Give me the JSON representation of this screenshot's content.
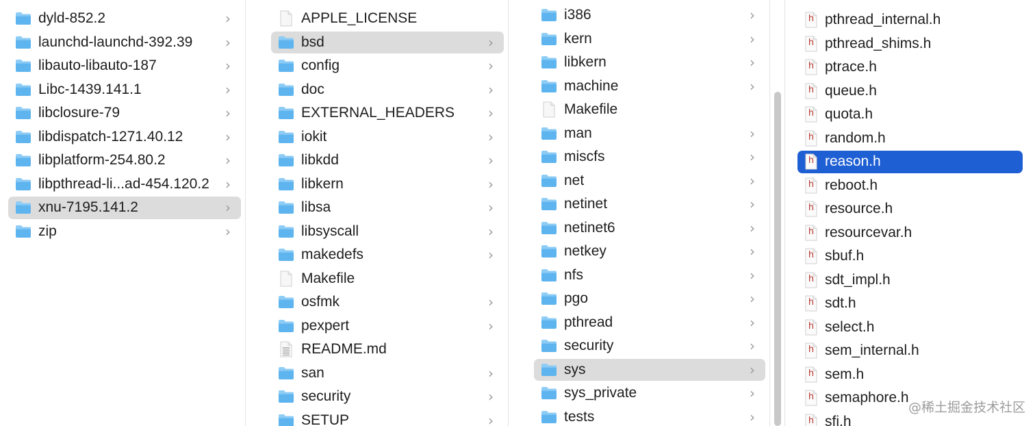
{
  "columns": [
    {
      "items": [
        {
          "label": "dyld-852.2",
          "type": "folder",
          "chevron": true
        },
        {
          "label": "launchd-launchd-392.39",
          "type": "folder",
          "chevron": true
        },
        {
          "label": "libauto-libauto-187",
          "type": "folder",
          "chevron": true
        },
        {
          "label": "Libc-1439.141.1",
          "type": "folder",
          "chevron": true
        },
        {
          "label": "libclosure-79",
          "type": "folder",
          "chevron": true
        },
        {
          "label": "libdispatch-1271.40.12",
          "type": "folder",
          "chevron": true
        },
        {
          "label": "libplatform-254.80.2",
          "type": "folder",
          "chevron": true
        },
        {
          "label": "libpthread-li...ad-454.120.2",
          "type": "folder",
          "chevron": true
        },
        {
          "label": "xnu-7195.141.2",
          "type": "folder",
          "chevron": true,
          "selected": "grey"
        },
        {
          "label": "zip",
          "type": "folder",
          "chevron": true
        }
      ]
    },
    {
      "items": [
        {
          "label": "APPLE_LICENSE",
          "type": "doc",
          "chevron": false
        },
        {
          "label": "bsd",
          "type": "folder",
          "chevron": true,
          "selected": "grey"
        },
        {
          "label": "config",
          "type": "folder",
          "chevron": true
        },
        {
          "label": "doc",
          "type": "folder",
          "chevron": true
        },
        {
          "label": "EXTERNAL_HEADERS",
          "type": "folder",
          "chevron": true
        },
        {
          "label": "iokit",
          "type": "folder",
          "chevron": true
        },
        {
          "label": "libkdd",
          "type": "folder",
          "chevron": true
        },
        {
          "label": "libkern",
          "type": "folder",
          "chevron": true
        },
        {
          "label": "libsa",
          "type": "folder",
          "chevron": true
        },
        {
          "label": "libsyscall",
          "type": "folder",
          "chevron": true
        },
        {
          "label": "makedefs",
          "type": "folder",
          "chevron": true
        },
        {
          "label": "Makefile",
          "type": "doc",
          "chevron": false
        },
        {
          "label": "osfmk",
          "type": "folder",
          "chevron": true
        },
        {
          "label": "pexpert",
          "type": "folder",
          "chevron": true
        },
        {
          "label": "README.md",
          "type": "textdoc",
          "chevron": false
        },
        {
          "label": "san",
          "type": "folder",
          "chevron": true
        },
        {
          "label": "security",
          "type": "folder",
          "chevron": true
        },
        {
          "label": "SETUP",
          "type": "folder",
          "chevron": true
        }
      ]
    },
    {
      "items": [
        {
          "label": "i386",
          "type": "folder",
          "chevron": true
        },
        {
          "label": "kern",
          "type": "folder",
          "chevron": true
        },
        {
          "label": "libkern",
          "type": "folder",
          "chevron": true
        },
        {
          "label": "machine",
          "type": "folder",
          "chevron": true
        },
        {
          "label": "Makefile",
          "type": "doc",
          "chevron": false
        },
        {
          "label": "man",
          "type": "folder",
          "chevron": true
        },
        {
          "label": "miscfs",
          "type": "folder",
          "chevron": true
        },
        {
          "label": "net",
          "type": "folder",
          "chevron": true
        },
        {
          "label": "netinet",
          "type": "folder",
          "chevron": true
        },
        {
          "label": "netinet6",
          "type": "folder",
          "chevron": true
        },
        {
          "label": "netkey",
          "type": "folder",
          "chevron": true
        },
        {
          "label": "nfs",
          "type": "folder",
          "chevron": true
        },
        {
          "label": "pgo",
          "type": "folder",
          "chevron": true
        },
        {
          "label": "pthread",
          "type": "folder",
          "chevron": true
        },
        {
          "label": "security",
          "type": "folder",
          "chevron": true
        },
        {
          "label": "sys",
          "type": "folder",
          "chevron": true,
          "selected": "grey"
        },
        {
          "label": "sys_private",
          "type": "folder",
          "chevron": true
        },
        {
          "label": "tests",
          "type": "folder",
          "chevron": true
        }
      ]
    },
    {
      "items": [
        {
          "label": "pthread_internal.h",
          "type": "h"
        },
        {
          "label": "pthread_shims.h",
          "type": "h"
        },
        {
          "label": "ptrace.h",
          "type": "h"
        },
        {
          "label": "queue.h",
          "type": "h"
        },
        {
          "label": "quota.h",
          "type": "h"
        },
        {
          "label": "random.h",
          "type": "h"
        },
        {
          "label": "reason.h",
          "type": "h",
          "selected": "blue"
        },
        {
          "label": "reboot.h",
          "type": "h"
        },
        {
          "label": "resource.h",
          "type": "h"
        },
        {
          "label": "resourcevar.h",
          "type": "h"
        },
        {
          "label": "sbuf.h",
          "type": "h"
        },
        {
          "label": "sdt_impl.h",
          "type": "h"
        },
        {
          "label": "sdt.h",
          "type": "h"
        },
        {
          "label": "select.h",
          "type": "h"
        },
        {
          "label": "sem_internal.h",
          "type": "h"
        },
        {
          "label": "sem.h",
          "type": "h"
        },
        {
          "label": "semaphore.h",
          "type": "h"
        },
        {
          "label": "sfi.h",
          "type": "h"
        }
      ]
    }
  ],
  "icons": {
    "folder": "folder-icon",
    "doc": "document-icon",
    "textdoc": "text-document-icon",
    "h": "header-file-icon",
    "chevron": "chevron-right-icon",
    "h_letter": "h"
  },
  "colors": {
    "folder_top": "#8ecdf6",
    "folder_body": "#5eb4ee",
    "selection_grey": "#dcdcdc",
    "selection_blue": "#1f5fd4",
    "h_letter": "#b4312a"
  },
  "watermark": "@稀土掘金技术社区"
}
